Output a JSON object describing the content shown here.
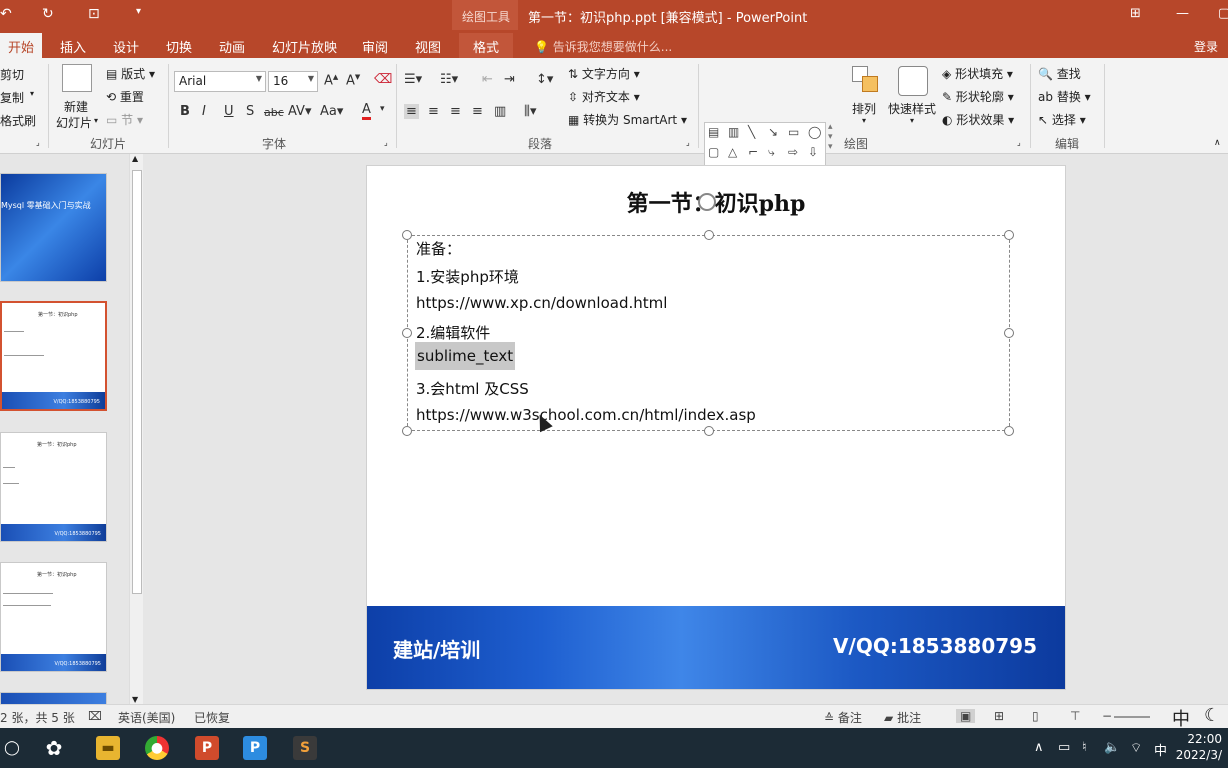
{
  "title": {
    "context": "绘图工具",
    "doc": "第一节：初识php.ppt [兼容模式] - PowerPoint"
  },
  "tabs": [
    "开始",
    "插入",
    "设计",
    "切换",
    "动画",
    "幻灯片放映",
    "审阅",
    "视图",
    "格式"
  ],
  "tellme": "告诉我您想要做什么...",
  "login": "登录",
  "clipboard": {
    "cut": "剪切",
    "copy": "复制",
    "painter": "格式刷"
  },
  "slides_group": {
    "new": "新建",
    "new2": "幻灯片",
    "layout": "版式",
    "reset": "重置",
    "section": "节",
    "label": "幻灯片"
  },
  "font": {
    "name": "Arial",
    "size": "16",
    "label": "字体"
  },
  "paragraph": {
    "text_dir": "文字方向",
    "align_text": "对齐文本",
    "smartart": "转换为 SmartArt",
    "label": "段落"
  },
  "drawing": {
    "arrange": "排列",
    "quick_styles": "快速样式",
    "fill": "形状填充",
    "outline": "形状轮廓",
    "effects": "形状效果",
    "label": "绘图"
  },
  "editing": {
    "find": "查找",
    "replace": "替换",
    "select": "选择",
    "label": "编辑"
  },
  "thumbs": {
    "t1": "Mysql 零基础入门与实战",
    "band": "V/QQ:1853880795",
    "slide_title": "第一节：初识php"
  },
  "slide": {
    "title": "第一节：初识php",
    "lines": [
      "准备：",
      "1.安装php环境",
      "https://www.xp.cn/download.html",
      "2.编辑软件",
      "sublime_text",
      "3.会html 及CSS",
      "https://www.w3school.com.cn/html/index.asp"
    ],
    "footer_left": "建站/培训",
    "footer_right": "V/QQ:1853880795"
  },
  "status": {
    "slide_count": "2 张，共 5 张",
    "lang": "英语(美国)",
    "recovered": "已恢复",
    "notes": "备注",
    "comments": "批注"
  },
  "taskbar": {
    "ime": "中",
    "time": "22:00",
    "date": "2022/3/"
  }
}
